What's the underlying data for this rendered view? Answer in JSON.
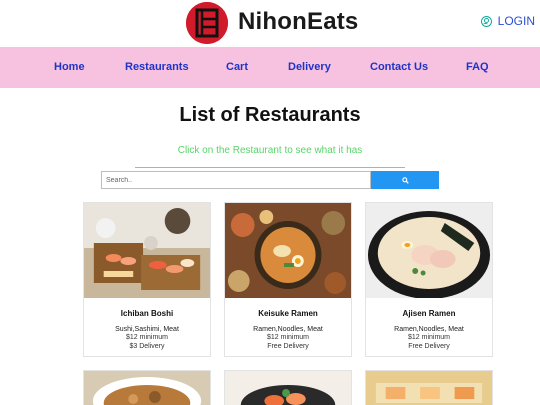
{
  "brand": {
    "name": "NihonEats"
  },
  "header": {
    "login_label": "LOGIN"
  },
  "nav": {
    "items": [
      {
        "label": "Home"
      },
      {
        "label": "Restaurants"
      },
      {
        "label": "Cart"
      },
      {
        "label": "Delivery"
      },
      {
        "label": "Contact Us"
      },
      {
        "label": "FAQ"
      }
    ]
  },
  "main": {
    "title": "List of Restaurants",
    "subtitle": "Click on the Restaurant to see what it has"
  },
  "search": {
    "placeholder": "Search.."
  },
  "restaurants": [
    {
      "name": "Ichiban Boshi",
      "tags": "Sushi,Sashimi, Meat",
      "minimum": "$12 minimum",
      "delivery": "$3 Delivery"
    },
    {
      "name": "Keisuke Ramen",
      "tags": "Ramen,Noodles, Meat",
      "minimum": "$12 minimum",
      "delivery": "Free Delivery"
    },
    {
      "name": "Ajisen Ramen",
      "tags": "Ramen,Noodles, Meat",
      "minimum": "$12 minimum",
      "delivery": "Free Delivery"
    }
  ],
  "colors": {
    "accent": "#f7c2df",
    "nav_text": "#1f33c8",
    "search_button": "#2196f3",
    "subtitle": "#5ad36a",
    "logo": "#d11a2a"
  }
}
